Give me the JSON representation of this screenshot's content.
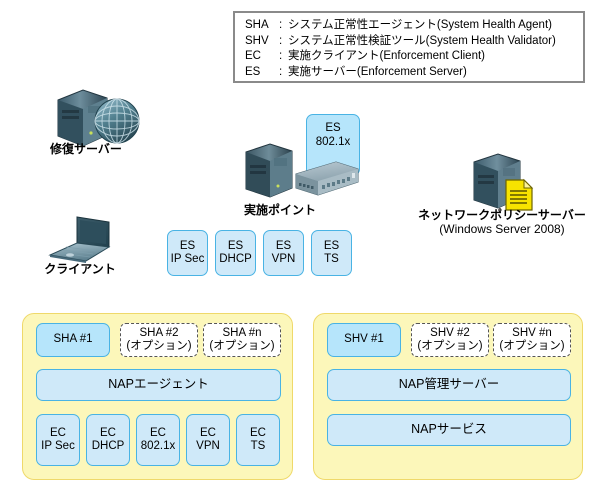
{
  "legend": {
    "rows": [
      {
        "abbr": "SHA",
        "colon": ":",
        "desc": "システム正常性エージェント(System Health Agent)"
      },
      {
        "abbr": "SHV",
        "colon": ":",
        "desc": "システム正常性検証ツール(System Health Validator)"
      },
      {
        "abbr": "EC",
        "colon": ":",
        "desc": "実施クライアント(Enforcement Client)"
      },
      {
        "abbr": "ES",
        "colon": ":",
        "desc": "実施サーバー(Enforcement Server)"
      }
    ]
  },
  "nodes": {
    "remediation_server": {
      "label": "修復サーバー",
      "icon": "server-globe-icon"
    },
    "client": {
      "label": "クライアント",
      "icon": "laptop-icon"
    },
    "enforcement_point": {
      "label": "実施ポイント",
      "icon": "server-switch-icon"
    },
    "policy_server": {
      "label": "ネットワークポリシーサーバー",
      "sublabel": "(Windows Server 2008)",
      "icon": "server-document-icon"
    }
  },
  "es_switch_box": {
    "line1": "ES",
    "line2": "802.1x"
  },
  "es_boxes": [
    {
      "line1": "ES",
      "line2": "IP Sec"
    },
    {
      "line1": "ES",
      "line2": "DHCP"
    },
    {
      "line1": "ES",
      "line2": "VPN"
    },
    {
      "line1": "ES",
      "line2": "TS"
    }
  ],
  "client_panel": {
    "sha_primary": "SHA  #1",
    "sha_optional": [
      {
        "line1": "SHA  #2",
        "line2": "(オプション)"
      },
      {
        "line1": "SHA  #n",
        "line2": "(オプション)"
      }
    ],
    "nap_agent": "NAPエージェント",
    "ec_boxes": [
      {
        "line1": "EC",
        "line2": "IP Sec"
      },
      {
        "line1": "EC",
        "line2": "DHCP"
      },
      {
        "line1": "EC",
        "line2": "802.1x"
      },
      {
        "line1": "EC",
        "line2": "VPN"
      },
      {
        "line1": "EC",
        "line2": "TS"
      }
    ]
  },
  "server_panel": {
    "shv_primary": "SHV  #1",
    "shv_optional": [
      {
        "line1": "SHV  #2",
        "line2": "(オプション)"
      },
      {
        "line1": "SHV  #n",
        "line2": "(オプション)"
      }
    ],
    "nap_admin_server": "NAP管理サーバー",
    "nap_service": "NAPサービス"
  },
  "colors": {
    "panel_fill": "#fcf7ba",
    "panel_border": "#efd96a",
    "box_fill": "#cfe9f9",
    "box_fill_bright": "#b6e5fb",
    "box_border": "#49b3e4",
    "legend_border": "#8a8a8a",
    "document_icon": "#f5e400"
  }
}
